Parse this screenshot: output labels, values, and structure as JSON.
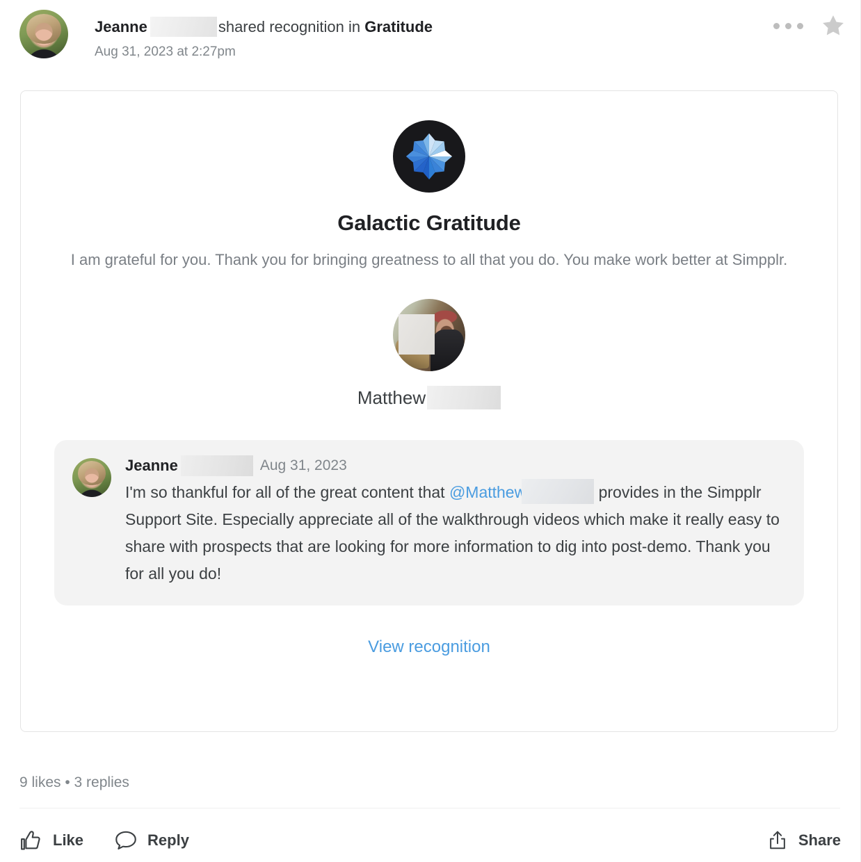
{
  "header": {
    "author_first_name": "Jeanne",
    "author_surname_redacted": true,
    "action_text": "shared recognition in",
    "space_name": "Gratitude",
    "timestamp": "Aug 31, 2023 at 2:27pm",
    "avatar_name": "jeanne-avatar",
    "more_menu_icon": "more-options-icon",
    "favorite_icon": "star-icon"
  },
  "recognition": {
    "badge_icon": "galactic-star-badge-icon",
    "title": "Galactic Gratitude",
    "description": "I am grateful for you. Thank you for bringing greatness to all that you do. You make work better at Simpplr.",
    "recipient": {
      "avatar_name": "matthew-avatar",
      "first_name": "Matthew",
      "surname_redacted": true
    },
    "comment": {
      "avatar_name": "jeanne-avatar",
      "author_first_name": "Jeanne",
      "author_surname_redacted": true,
      "date": "Aug 31, 2023",
      "text_before_mention": "I'm so thankful for all of the great content that ",
      "mention": "@Matthew",
      "text_after_mention": " provides in the Simpplr Support Site. Especially appreciate all of the walkthrough videos which make it really easy to share with prospects that are looking for more information to dig into post-demo. Thank you for all you do!"
    },
    "view_link_label": "View recognition"
  },
  "footer": {
    "stats": "9 likes • 3 replies",
    "like_label": "Like",
    "like_icon": "thumbs-up-icon",
    "reply_label": "Reply",
    "reply_icon": "speech-bubble-icon",
    "share_label": "Share",
    "share_icon": "share-export-icon"
  },
  "colors": {
    "link_blue": "#4a9ce0",
    "text_primary": "#3c4043",
    "text_secondary": "#80868b",
    "badge_background": "#18181b",
    "bubble_background": "#f3f3f3",
    "card_border": "#e4e4e4"
  }
}
